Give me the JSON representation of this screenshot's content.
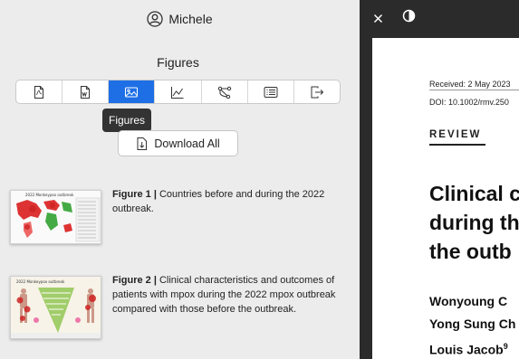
{
  "user": {
    "name": "Michele",
    "icon": "user-circle-icon"
  },
  "panel": {
    "section_title": "Figures",
    "toolbar": [
      {
        "name": "pdf-view-icon",
        "active": false
      },
      {
        "name": "word-doc-icon",
        "active": false
      },
      {
        "name": "figures-icon",
        "active": true
      },
      {
        "name": "chart-icon",
        "active": false
      },
      {
        "name": "graph-network-icon",
        "active": false
      },
      {
        "name": "list-icon",
        "active": false
      },
      {
        "name": "export-icon",
        "active": false
      }
    ],
    "tooltip": "Figures",
    "download_label": "Download All",
    "figures": [
      {
        "label": "Figure 1 |",
        "caption": " Countries before and during the 2022 outbreak.",
        "thumb_title": "2022 Monkeypox outbreak"
      },
      {
        "label": "Figure 2 |",
        "caption": " Clinical characteristics and outcomes of patients with mpox during the 2022 mpox outbreak compared with those before the outbreak.",
        "thumb_title": "2022 Monkeypox outbreak"
      }
    ]
  },
  "viewer": {
    "received": "Received: 2 May 2023",
    "doi": "DOI: 10.1002/rmv.250",
    "section": "REVIEW",
    "title_lines": [
      "Clinical c",
      "during th",
      "the outb"
    ],
    "authors": [
      "Wonyoung C",
      "Yong Sung Ch",
      "Louis Jacob"
    ],
    "author_sup": "9",
    "colors": {
      "accent": "#1e6fe6",
      "viewer_bg": "#2b2b2b"
    }
  }
}
